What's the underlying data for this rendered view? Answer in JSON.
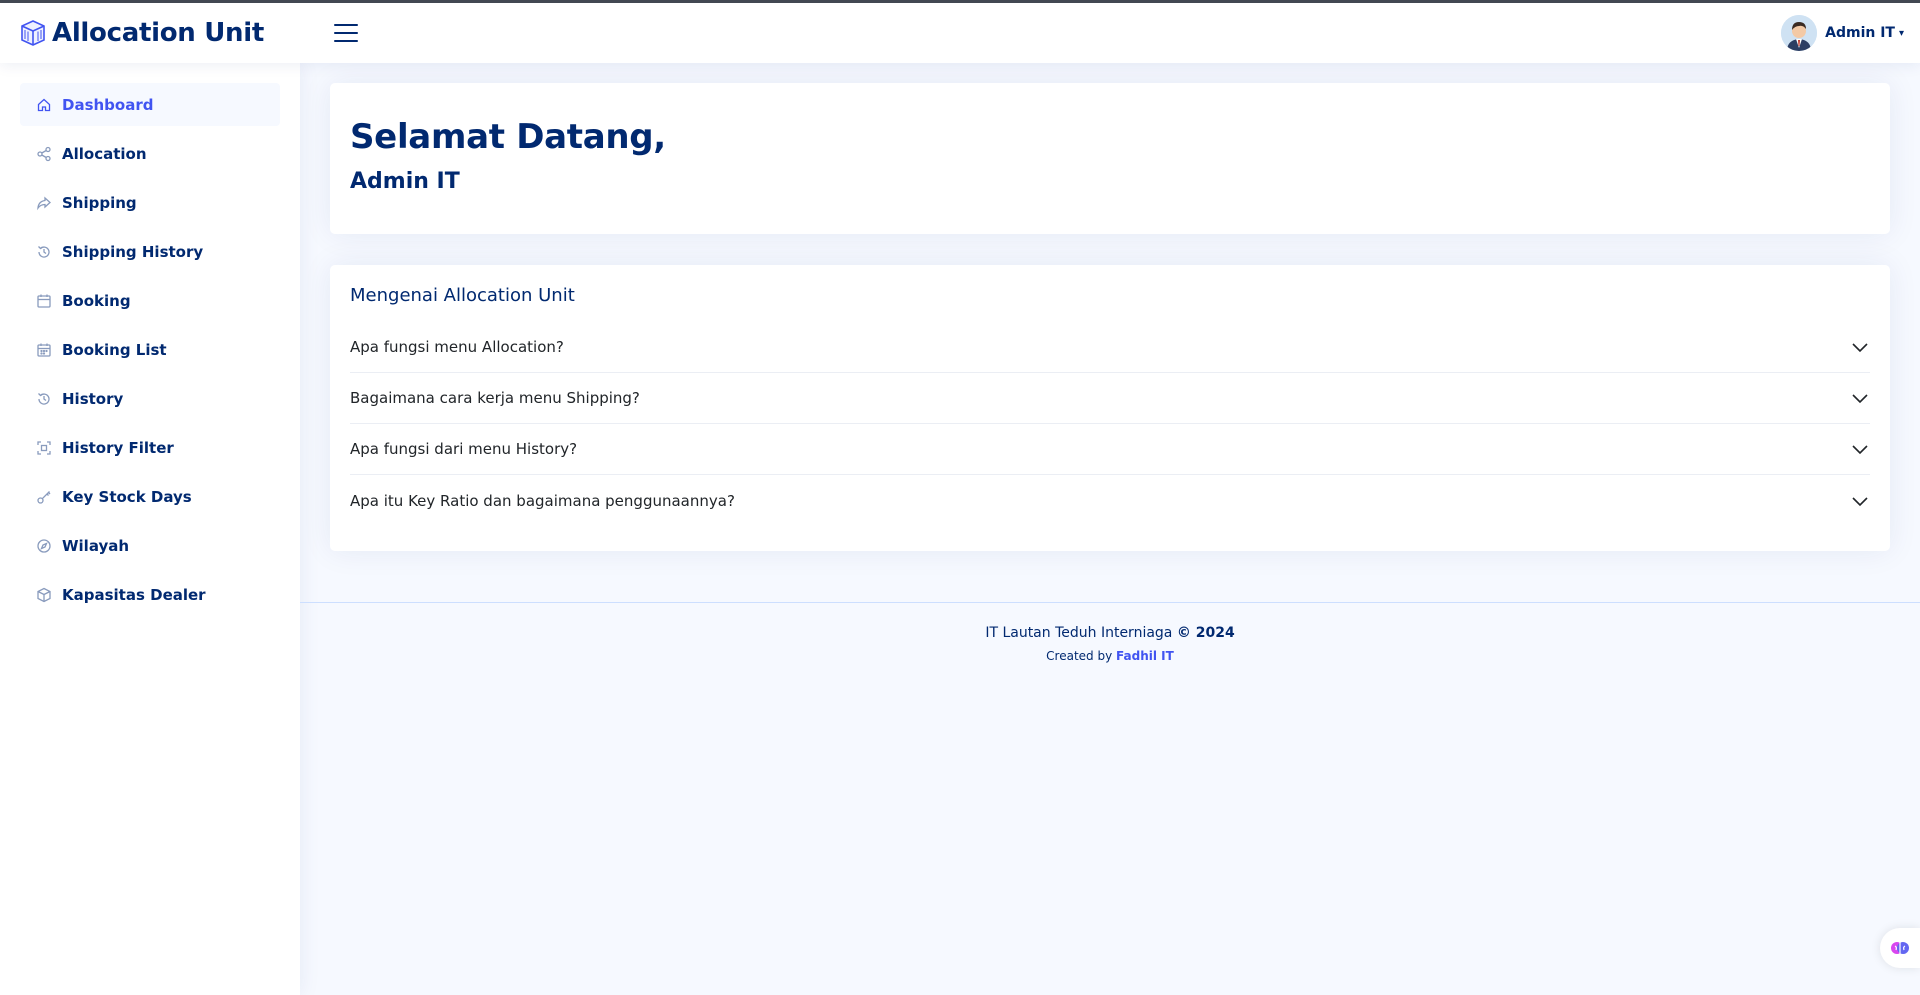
{
  "app": {
    "title": "Allocation Unit"
  },
  "header": {
    "user_name": "Admin IT"
  },
  "sidebar": {
    "items": [
      {
        "label": "Dashboard",
        "icon": "house-icon",
        "active": true
      },
      {
        "label": "Allocation",
        "icon": "share-icon"
      },
      {
        "label": "Shipping",
        "icon": "forward-icon"
      },
      {
        "label": "Shipping History",
        "icon": "history-icon"
      },
      {
        "label": "Booking",
        "icon": "calendar-icon"
      },
      {
        "label": "Booking List",
        "icon": "calendar-grid-icon"
      },
      {
        "label": "History",
        "icon": "history-icon"
      },
      {
        "label": "History Filter",
        "icon": "filter-icon"
      },
      {
        "label": "Key Stock Days",
        "icon": "key-icon"
      },
      {
        "label": "Wilayah",
        "icon": "compass-icon"
      },
      {
        "label": "Kapasitas Dealer",
        "icon": "box-icon"
      }
    ]
  },
  "welcome": {
    "greeting": "Selamat Datang,",
    "user": "Admin IT"
  },
  "about": {
    "title": "Mengenai Allocation Unit",
    "faq": [
      "Apa fungsi menu Allocation?",
      "Bagaimana cara kerja menu Shipping?",
      "Apa fungsi dari menu History?",
      "Apa itu Key Ratio dan bagaimana penggunaannya?"
    ]
  },
  "footer": {
    "company": "IT Lautan Teduh Interniaga",
    "copyright": "© 2024",
    "created_by": "Created by",
    "author": "Fadhil IT"
  },
  "colors": {
    "primary": "#012970",
    "accent": "#4154f1",
    "background": "#f6f9ff"
  }
}
